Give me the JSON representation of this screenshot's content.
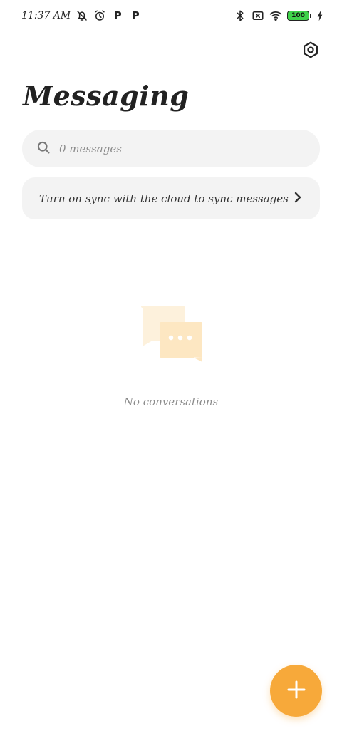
{
  "status_bar": {
    "time": "11:37 AM",
    "left_icons": [
      "notifications-off-icon",
      "alarm-icon",
      "p-icon",
      "p-icon"
    ],
    "p_label": "P",
    "right_icons": [
      "bluetooth-icon",
      "no-sim-icon",
      "wifi-icon"
    ],
    "battery_level": "100",
    "charging": true
  },
  "header": {
    "title": "Messaging",
    "settings_icon": "settings-icon"
  },
  "search": {
    "placeholder": "0 messages"
  },
  "sync_banner": {
    "text": "Turn on sync with the cloud to sync messages"
  },
  "empty_state": {
    "message": "No conversations"
  },
  "fab": {
    "icon": "plus-icon"
  },
  "colors": {
    "accent": "#f7a93a",
    "card_bg": "#f3f3f3",
    "battery": "#3fd34a",
    "illustration_back": "#fdf1dc",
    "illustration_front": "#fde7c2"
  }
}
